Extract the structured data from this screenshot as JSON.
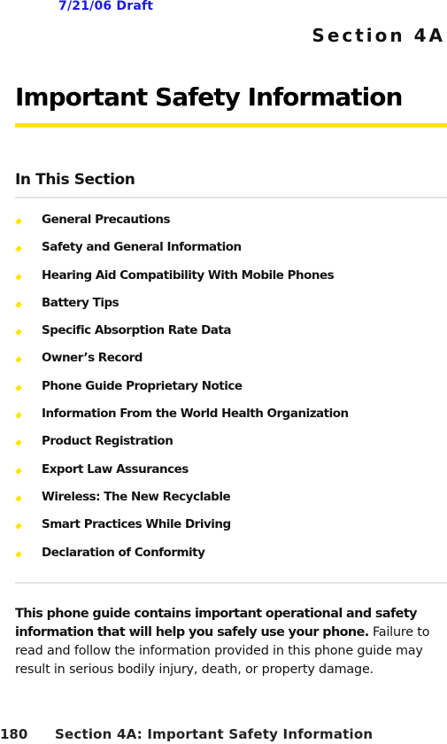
{
  "header": {
    "draft_label": "7/21/06 Draft",
    "section_tag": "Section 4A"
  },
  "page": {
    "title": "Important Safety Information",
    "accent_color": "#ffe600",
    "draft_color": "#1a1adc"
  },
  "in_this_section": {
    "heading": "In This Section",
    "bullet_icon": "yellow-diamond",
    "items": [
      {
        "label": "General Precautions"
      },
      {
        "label": "Safety and General Information"
      },
      {
        "label": "Hearing Aid Compatibility With Mobile Phones"
      },
      {
        "label": "Battery Tips"
      },
      {
        "label": "Specific Absorption Rate Data"
      },
      {
        "label": "Owner’s Record"
      },
      {
        "label": "Phone Guide Proprietary Notice"
      },
      {
        "label": "Information From the World Health Organization"
      },
      {
        "label": "Product Registration"
      },
      {
        "label": "Export Law Assurances"
      },
      {
        "label": "Wireless: The New Recyclable"
      },
      {
        "label": "Smart Practices While Driving"
      },
      {
        "label": "Declaration of Conformity"
      }
    ]
  },
  "intro": {
    "bold_text": "This phone guide contains important operational and safety information that will help you safely use your phone.",
    "regular_text": " Failure to read and follow the information provided in this phone guide may result in serious bodily injury, death, or property damage."
  },
  "footer": {
    "page_number": "180",
    "running_title": "Section 4A: Important Safety Information"
  }
}
